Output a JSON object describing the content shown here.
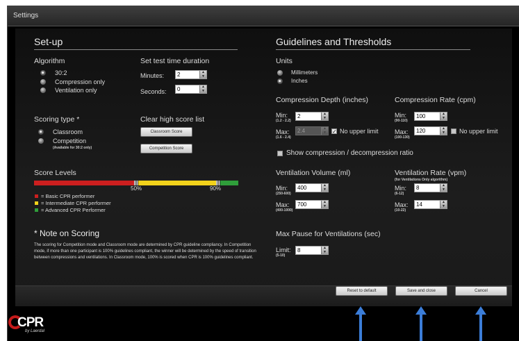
{
  "window": {
    "title": "Settings"
  },
  "setup": {
    "heading": "Set-up",
    "algorithm": {
      "heading": "Algorithm",
      "options": [
        "30:2",
        "Compression only",
        "Ventilation only"
      ],
      "selected": "30:2"
    },
    "test_time": {
      "heading": "Set test time duration",
      "minutes_label": "Minutes:",
      "minutes_value": "2",
      "seconds_label": "Seconds:",
      "seconds_value": "0"
    },
    "scoring": {
      "heading": "Scoring type *",
      "options": [
        "Classroom",
        "Competition"
      ],
      "competition_note": "(Available for 30:2 only)",
      "selected": "Classroom"
    },
    "clear_scores": {
      "heading": "Clear high score list",
      "classroom_button": "Classroom Score",
      "competition_button": "Competition Score"
    },
    "score_levels": {
      "heading": "Score Levels",
      "threshold_low": "50%",
      "threshold_high": "90%",
      "threshold_low_value": 50,
      "threshold_high_value": 90,
      "colors": {
        "basic": "#cc1f1f",
        "intermediate": "#f2d21b",
        "advanced": "#2f9e3a"
      },
      "legend": [
        {
          "color": "#cc1f1f",
          "label": "= Basic CPR performer"
        },
        {
          "color": "#f2d21b",
          "label": "= Intermediate CPR performer"
        },
        {
          "color": "#2f9e3a",
          "label": "= Advanced CPR Performer"
        }
      ]
    },
    "note": {
      "heading": "* Note on Scoring",
      "text": "The scoring for Competition mode and Classroom mode are determined by CPR guideline compliancy. In Competition mode, if more than one participant is 100% guidelines compliant, the winner will be determined by the speed of transition between compressions and ventilations. In Classroom mode, 100% is scored when CPR is 100% guidelines compliant."
    }
  },
  "guidelines": {
    "heading": "Guidelines and Thresholds",
    "units": {
      "heading": "Units",
      "options": [
        "Millimeters",
        "Inches"
      ],
      "selected": "Inches"
    },
    "compression_depth": {
      "heading": "Compression Depth (inches)",
      "min_label": "Min:",
      "min_range": "(1.2 - 2.2)",
      "min_value": "2",
      "max_label": "Max:",
      "max_range": "(1.6 - 2.4)",
      "max_value": "2.4",
      "no_upper_label": "No upper limit",
      "no_upper_checked": true
    },
    "compression_rate": {
      "heading": "Compression Rate (cpm)",
      "min_label": "Min:",
      "min_range": "(90-110)",
      "min_value": "100",
      "max_label": "Max:",
      "max_range": "(100-130)",
      "max_value": "120",
      "no_upper_label": "No upper limit",
      "no_upper_checked": false
    },
    "show_ratio_label": "Show compression / decompression ratio",
    "ventilation_volume": {
      "heading": "Ventilation Volume (ml)",
      "min_label": "Min:",
      "min_range": "(250-600)",
      "min_value": "400",
      "max_label": "Max:",
      "max_range": "(400-1000)",
      "max_value": "700"
    },
    "ventilation_rate": {
      "heading": "Ventilation Rate (vpm)",
      "sub": "(for Ventilations Only algorithm)",
      "min_label": "Min:",
      "min_range": "(6-12)",
      "min_value": "8",
      "max_label": "Max:",
      "max_range": "(10-22)",
      "max_value": "14"
    },
    "max_pause": {
      "heading": "Max Pause for Ventilations (sec)",
      "limit_label": "Limit:",
      "limit_range": "(5-10)",
      "limit_value": "8"
    }
  },
  "footer": {
    "reset_button": "Reset to default",
    "save_button": "Save and close",
    "cancel_button": "Cancel",
    "logo_text": "CPR",
    "logo_sub": "by Laerdal"
  },
  "icons": {
    "spinner": "up-down-arrows-icon",
    "pointer": "up-arrow-icon"
  }
}
